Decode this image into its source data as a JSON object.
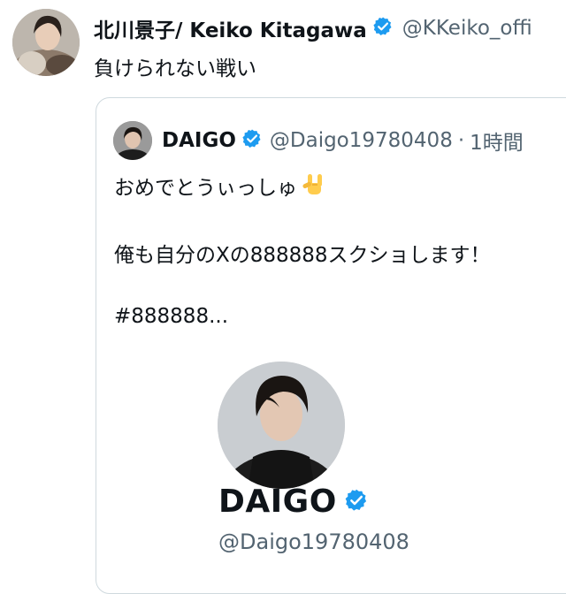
{
  "tweet": {
    "author_name": "北川景子/ Keiko Kitagawa",
    "author_handle": "@KKeiko_offi",
    "text": "負けられない戦い"
  },
  "quoted_tweet": {
    "author_name": "DAIGO",
    "author_handle": "@Daigo19780408",
    "separator": "·",
    "time": "1時間",
    "line1": "おめでとうぃっしゅ",
    "line1_emoji": "sign-of-horns-emoji",
    "line2": "俺も自分のXの888888スクショします！",
    "line3": "#888888..."
  },
  "embedded_profile": {
    "name": "DAIGO",
    "handle": "@Daigo19780408"
  },
  "icons": {
    "verified": "verified-badge-icon",
    "verified_color": "#1d9bf0"
  }
}
